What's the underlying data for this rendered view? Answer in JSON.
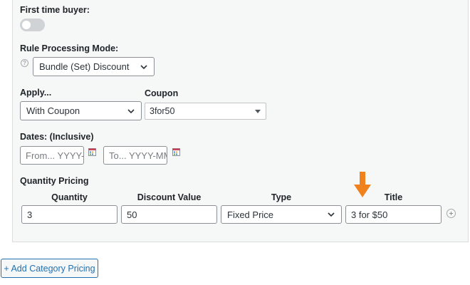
{
  "first_time_buyer": {
    "label": "First time buyer:",
    "enabled": false
  },
  "rule_processing": {
    "label": "Rule Processing Mode:",
    "value": "Bundle (Set) Discount"
  },
  "apply": {
    "label": "Apply...",
    "value": "With Coupon"
  },
  "coupon": {
    "label": "Coupon",
    "value": "3for50"
  },
  "dates": {
    "label": "Dates: (Inclusive)",
    "from_placeholder": "From... YYYY-",
    "to_placeholder": "To... YYYY-MM"
  },
  "quantity_pricing": {
    "label": "Quantity Pricing",
    "columns": [
      "Quantity",
      "Discount Value",
      "Type",
      "Title"
    ],
    "row": {
      "quantity": "3",
      "discount_value": "50",
      "type": "Fixed Price",
      "title": "3 for $50"
    }
  },
  "add_category_button": "+ Add Category Pricing",
  "colors": {
    "accent": "#2271b1",
    "arrow": "#f0821e",
    "panel_bg": "#f6f7f7"
  }
}
